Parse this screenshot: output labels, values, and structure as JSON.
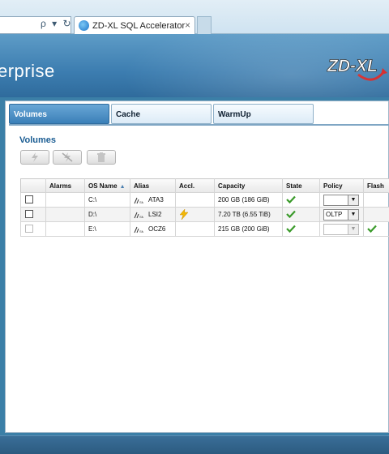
{
  "browser": {
    "tab_title": "ZD-XL SQL Accelerator",
    "close_glyph": "×",
    "address_icons": "ρ ▾ ↻"
  },
  "banner": {
    "title": "erprise",
    "logo_text": "ZD-XL"
  },
  "tabs": [
    "Volumes",
    "Cache",
    "WarmUp"
  ],
  "volumes": {
    "section_title": "Volumes",
    "toolbar": [
      "accelerate-icon",
      "remove-acceleration-icon",
      "delete-icon"
    ]
  },
  "table": {
    "headers": [
      "",
      "Alarms",
      "OS Name",
      "Alias",
      "Accl.",
      "Capacity",
      "State",
      "Policy",
      "Flash"
    ],
    "rows": [
      {
        "os_name": "C:\\",
        "alias": "ATA3",
        "accelerated": false,
        "capacity": "200 GB (186 GiB)",
        "state": "ok",
        "policy": "",
        "flash": false
      },
      {
        "os_name": "D:\\",
        "alias": "LSI2",
        "accelerated": true,
        "capacity": "7.20 TB (6.55 TiB)",
        "state": "ok",
        "policy": "OLTP",
        "flash": false
      },
      {
        "os_name": "E:\\",
        "alias": "OCZ6",
        "accelerated": false,
        "capacity": "215 GB (200 GiB)",
        "state": "ok",
        "policy": "",
        "flash": true
      }
    ]
  },
  "colors": {
    "accent": "#1b5d93",
    "check_green": "#3a9a2a",
    "bolt_yellow": "#f2b705",
    "banner_blue": "#3c7db0"
  }
}
